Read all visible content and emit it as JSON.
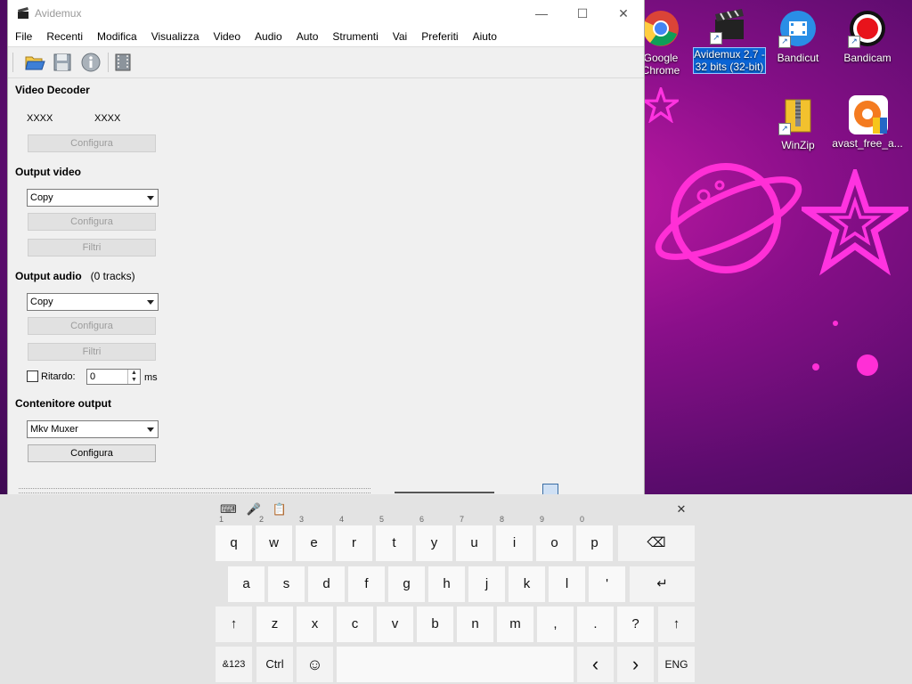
{
  "window": {
    "title": "Avidemux",
    "controls": {
      "minimize": "—",
      "maximize": "☐",
      "close": "✕"
    }
  },
  "menu": [
    "File",
    "Recenti",
    "Modifica",
    "Visualizza",
    "Video",
    "Audio",
    "Auto",
    "Strumenti",
    "Vai",
    "Preferiti",
    "Aiuto"
  ],
  "video_decoder": {
    "heading": "Video Decoder",
    "value1": "XXXX",
    "value2": "XXXX",
    "configure": "Configura"
  },
  "output_video": {
    "heading": "Output video",
    "codec": "Copy",
    "configure": "Configura",
    "filters": "Filtri"
  },
  "output_audio": {
    "heading": "Output audio",
    "tracks": "(0 tracks)",
    "codec": "Copy",
    "configure": "Configura",
    "filters": "Filtri",
    "delay_label": "Ritardo:",
    "delay_value": "0",
    "delay_unit": "ms"
  },
  "container": {
    "heading": "Contenitore output",
    "muxer": "Mkv Muxer",
    "configure": "Configura"
  },
  "desktop_icons": [
    {
      "label": "Google Chrome"
    },
    {
      "label": "Avidemux 2.7 - 32 bits (32-bit)"
    },
    {
      "label": "Bandicut"
    },
    {
      "label": "Bandicam"
    },
    {
      "label": "WinZip"
    },
    {
      "label": "avast_free_a..."
    }
  ],
  "keyboard": {
    "tools": {
      "layout": "⌨",
      "mic": "🎤",
      "clipboard": "📋",
      "close": "✕"
    },
    "row1": [
      {
        "k": "q",
        "h": "1"
      },
      {
        "k": "w",
        "h": "2"
      },
      {
        "k": "e",
        "h": "3"
      },
      {
        "k": "r",
        "h": "4"
      },
      {
        "k": "t",
        "h": "5"
      },
      {
        "k": "y",
        "h": "6"
      },
      {
        "k": "u",
        "h": "7"
      },
      {
        "k": "i",
        "h": "8"
      },
      {
        "k": "o",
        "h": "9"
      },
      {
        "k": "p",
        "h": "0"
      }
    ],
    "backspace": "⌫",
    "row2": [
      "a",
      "s",
      "d",
      "f",
      "g",
      "h",
      "j",
      "k",
      "l",
      "'"
    ],
    "enter": "↵",
    "shift": "↑",
    "row3": [
      "z",
      "x",
      "c",
      "v",
      "b",
      "n",
      "m",
      ",",
      ".",
      "?"
    ],
    "sym": "&123",
    "ctrl": "Ctrl",
    "emoji": "☺",
    "left": "‹",
    "right": "›",
    "lang": "ENG"
  }
}
